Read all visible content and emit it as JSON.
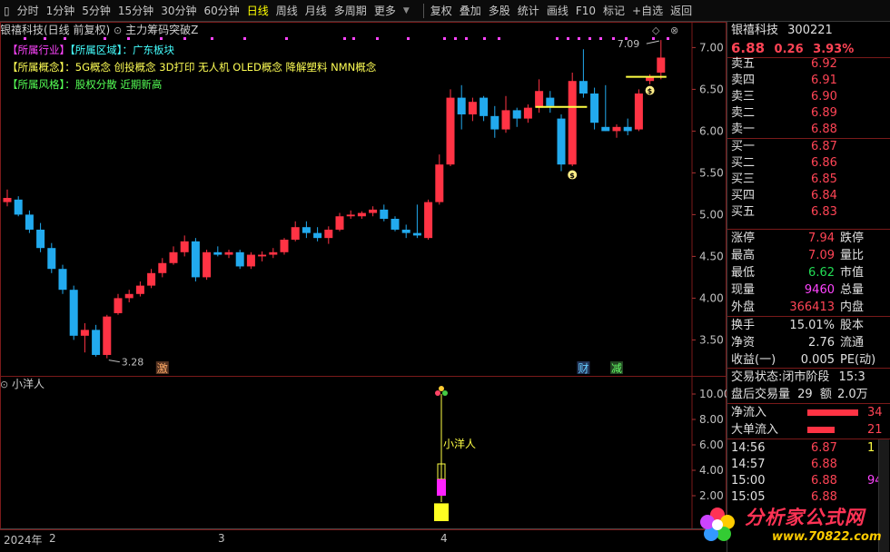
{
  "toolbar": {
    "items": [
      "分时",
      "1分钟",
      "5分钟",
      "15分钟",
      "30分钟",
      "60分钟",
      "日线",
      "周线",
      "月线",
      "多周期",
      "更多"
    ],
    "active_index": 6,
    "right_items": [
      "复权",
      "叠加",
      "多股",
      "统计",
      "画线",
      "F10",
      "标记",
      "+自选",
      "返回"
    ]
  },
  "chart": {
    "header_title": "银禧科技(日线 前复权)",
    "indicator_name": "主力筹码突破Z",
    "info": {
      "line1_tag1": "【所属行业】",
      "line1_tag2": "【所属区域】",
      "line1_value": "：广东板块",
      "line2_tag": "【所属概念】",
      "line2_value": "：5G概念 创投概念 3D打印 无人机 OLED概念 降解塑料 NMN概念",
      "line3_tag": "【所属风格】",
      "line3_value": "：股权分散 近期新高"
    },
    "high_label": "7.09",
    "low_label": "3.28",
    "event_marks": [
      "激",
      "财",
      "减"
    ],
    "y_ticks": [
      "7.00",
      "6.50",
      "6.00",
      "5.50",
      "5.00",
      "4.50",
      "4.00",
      "3.50"
    ],
    "sub_title": "小洋人",
    "sub_label": "小洋人",
    "sub_y_ticks": [
      "10.00",
      "8.00",
      "6.00",
      "4.00",
      "2.00"
    ],
    "x_labels": [
      "2024年",
      "2",
      "3",
      "4"
    ],
    "up_color": "#ff3344",
    "down_color": "#22aaee"
  },
  "chart_data": {
    "type": "candlestick",
    "ylim": [
      3.2,
      7.2
    ],
    "candles": [
      {
        "o": 5.15,
        "h": 5.3,
        "l": 5.1,
        "c": 5.2
      },
      {
        "o": 5.18,
        "h": 5.22,
        "l": 4.98,
        "c": 5.0
      },
      {
        "o": 5.0,
        "h": 5.05,
        "l": 4.78,
        "c": 4.82
      },
      {
        "o": 4.82,
        "h": 4.9,
        "l": 4.55,
        "c": 4.6
      },
      {
        "o": 4.6,
        "h": 4.66,
        "l": 4.3,
        "c": 4.35
      },
      {
        "o": 4.35,
        "h": 4.4,
        "l": 4.05,
        "c": 4.1
      },
      {
        "o": 4.1,
        "h": 4.15,
        "l": 3.5,
        "c": 3.55
      },
      {
        "o": 3.55,
        "h": 3.7,
        "l": 3.35,
        "c": 3.62
      },
      {
        "o": 3.62,
        "h": 3.68,
        "l": 3.3,
        "c": 3.32
      },
      {
        "o": 3.32,
        "h": 3.8,
        "l": 3.28,
        "c": 3.78
      },
      {
        "o": 3.82,
        "h": 4.05,
        "l": 3.8,
        "c": 4.0
      },
      {
        "o": 4.0,
        "h": 4.1,
        "l": 3.95,
        "c": 4.05
      },
      {
        "o": 4.05,
        "h": 4.2,
        "l": 4.02,
        "c": 4.15
      },
      {
        "o": 4.15,
        "h": 4.35,
        "l": 4.12,
        "c": 4.3
      },
      {
        "o": 4.3,
        "h": 4.48,
        "l": 4.25,
        "c": 4.42
      },
      {
        "o": 4.42,
        "h": 4.62,
        "l": 4.4,
        "c": 4.55
      },
      {
        "o": 4.55,
        "h": 4.75,
        "l": 4.5,
        "c": 4.68
      },
      {
        "o": 4.68,
        "h": 4.72,
        "l": 4.2,
        "c": 4.25
      },
      {
        "o": 4.25,
        "h": 4.58,
        "l": 4.22,
        "c": 4.55
      },
      {
        "o": 4.55,
        "h": 4.62,
        "l": 4.5,
        "c": 4.52
      },
      {
        "o": 4.52,
        "h": 4.58,
        "l": 4.48,
        "c": 4.55
      },
      {
        "o": 4.55,
        "h": 4.58,
        "l": 4.35,
        "c": 4.38
      },
      {
        "o": 4.38,
        "h": 4.55,
        "l": 4.35,
        "c": 4.52
      },
      {
        "o": 4.5,
        "h": 4.56,
        "l": 4.44,
        "c": 4.52
      },
      {
        "o": 4.52,
        "h": 4.6,
        "l": 4.48,
        "c": 4.55
      },
      {
        "o": 4.55,
        "h": 4.72,
        "l": 4.52,
        "c": 4.7
      },
      {
        "o": 4.7,
        "h": 4.92,
        "l": 4.68,
        "c": 4.85
      },
      {
        "o": 4.85,
        "h": 4.92,
        "l": 4.72,
        "c": 4.78
      },
      {
        "o": 4.78,
        "h": 4.85,
        "l": 4.68,
        "c": 4.72
      },
      {
        "o": 4.72,
        "h": 4.86,
        "l": 4.65,
        "c": 4.82
      },
      {
        "o": 4.82,
        "h": 5.02,
        "l": 4.8,
        "c": 4.98
      },
      {
        "o": 4.98,
        "h": 5.05,
        "l": 4.95,
        "c": 5.0
      },
      {
        "o": 4.98,
        "h": 5.04,
        "l": 4.95,
        "c": 5.02
      },
      {
        "o": 5.02,
        "h": 5.1,
        "l": 4.98,
        "c": 5.06
      },
      {
        "o": 5.06,
        "h": 5.12,
        "l": 4.92,
        "c": 4.95
      },
      {
        "o": 4.95,
        "h": 4.98,
        "l": 4.8,
        "c": 4.82
      },
      {
        "o": 4.82,
        "h": 4.88,
        "l": 4.72,
        "c": 4.78
      },
      {
        "o": 4.78,
        "h": 5.12,
        "l": 4.72,
        "c": 4.75
      },
      {
        "o": 4.72,
        "h": 5.18,
        "l": 4.7,
        "c": 5.15
      },
      {
        "o": 5.15,
        "h": 5.72,
        "l": 5.12,
        "c": 5.6
      },
      {
        "o": 5.6,
        "h": 6.5,
        "l": 5.58,
        "c": 6.4
      },
      {
        "o": 6.4,
        "h": 6.55,
        "l": 6.02,
        "c": 6.2
      },
      {
        "o": 6.2,
        "h": 6.4,
        "l": 6.12,
        "c": 6.35
      },
      {
        "o": 6.4,
        "h": 6.42,
        "l": 6.12,
        "c": 6.18
      },
      {
        "o": 6.18,
        "h": 6.3,
        "l": 5.92,
        "c": 6.02
      },
      {
        "o": 6.02,
        "h": 6.42,
        "l": 5.98,
        "c": 6.25
      },
      {
        "o": 6.25,
        "h": 6.28,
        "l": 6.05,
        "c": 6.15
      },
      {
        "o": 6.15,
        "h": 6.32,
        "l": 6.1,
        "c": 6.28
      },
      {
        "o": 6.28,
        "h": 6.62,
        "l": 6.22,
        "c": 6.48
      },
      {
        "o": 6.4,
        "h": 6.48,
        "l": 6.22,
        "c": 6.3
      },
      {
        "o": 6.15,
        "h": 6.2,
        "l": 5.52,
        "c": 5.6
      },
      {
        "o": 5.6,
        "h": 6.7,
        "l": 5.58,
        "c": 6.6
      },
      {
        "o": 6.6,
        "h": 6.98,
        "l": 6.4,
        "c": 6.45
      },
      {
        "o": 6.45,
        "h": 6.52,
        "l": 6.02,
        "c": 6.1
      },
      {
        "o": 6.05,
        "h": 6.55,
        "l": 6.0,
        "c": 6.0
      },
      {
        "o": 6.0,
        "h": 6.08,
        "l": 5.92,
        "c": 6.05
      },
      {
        "o": 6.05,
        "h": 6.15,
        "l": 5.95,
        "c": 6.0
      },
      {
        "o": 6.02,
        "h": 6.5,
        "l": 6.0,
        "c": 6.45
      },
      {
        "o": 6.6,
        "h": 6.68,
        "l": 6.56,
        "c": 6.65
      },
      {
        "o": 6.7,
        "h": 7.09,
        "l": 6.62,
        "c": 6.88
      }
    ],
    "sub_values": [
      10.0,
      4.0,
      2.0
    ]
  },
  "quote": {
    "name": "银禧科技",
    "code": "300221",
    "price": "6.88",
    "change": "0.26",
    "change_pct": "3.93%",
    "sell": [
      {
        "label": "卖五",
        "price": "6.92"
      },
      {
        "label": "卖四",
        "price": "6.91"
      },
      {
        "label": "卖三",
        "price": "6.90"
      },
      {
        "label": "卖二",
        "price": "6.89"
      },
      {
        "label": "卖一",
        "price": "6.88"
      }
    ],
    "buy": [
      {
        "label": "买一",
        "price": "6.87"
      },
      {
        "label": "买二",
        "price": "6.86"
      },
      {
        "label": "买三",
        "price": "6.85"
      },
      {
        "label": "买四",
        "price": "6.84"
      },
      {
        "label": "买五",
        "price": "6.83"
      }
    ],
    "stats": [
      {
        "l1": "涨停",
        "v1": "7.94",
        "l2": "跌停"
      },
      {
        "l1": "最高",
        "v1": "7.09",
        "l2": "量比"
      },
      {
        "l1": "最低",
        "v1": "6.62",
        "l2": "市值"
      },
      {
        "l1": "现量",
        "v1": "9460",
        "l2": "总量"
      },
      {
        "l1": "外盘",
        "v1": "366413",
        "l2": "内盘"
      }
    ],
    "stats2": [
      {
        "l1": "换手",
        "v1": "15.01%",
        "l2": "股本"
      },
      {
        "l1": "净资",
        "v1": "2.76",
        "l2": "流通"
      },
      {
        "l1": "收益(一)",
        "v1": "0.005",
        "l2": "PE(动)"
      }
    ],
    "trade_status_label": "交易状态:",
    "trade_status_value": "闭市阶段",
    "trade_status_time": "15:3",
    "after_hours_label": "盘后交易量",
    "after_hours_value": "29",
    "after_hours_amount_label": "额",
    "after_hours_amount": "2.0万",
    "flow": [
      {
        "label": "净流入",
        "value": "34"
      },
      {
        "label": "大单流入",
        "value": "21"
      }
    ],
    "ticks": [
      {
        "time": "14:56",
        "price": "6.87",
        "vol": "1"
      },
      {
        "time": "14:57",
        "price": "6.88",
        "vol": ""
      },
      {
        "time": "15:00",
        "price": "6.88",
        "vol": "94"
      },
      {
        "time": "15:05",
        "price": "6.88",
        "vol": ""
      }
    ]
  },
  "watermark": {
    "text": "分析家公式网",
    "url": "www.70822.com"
  }
}
